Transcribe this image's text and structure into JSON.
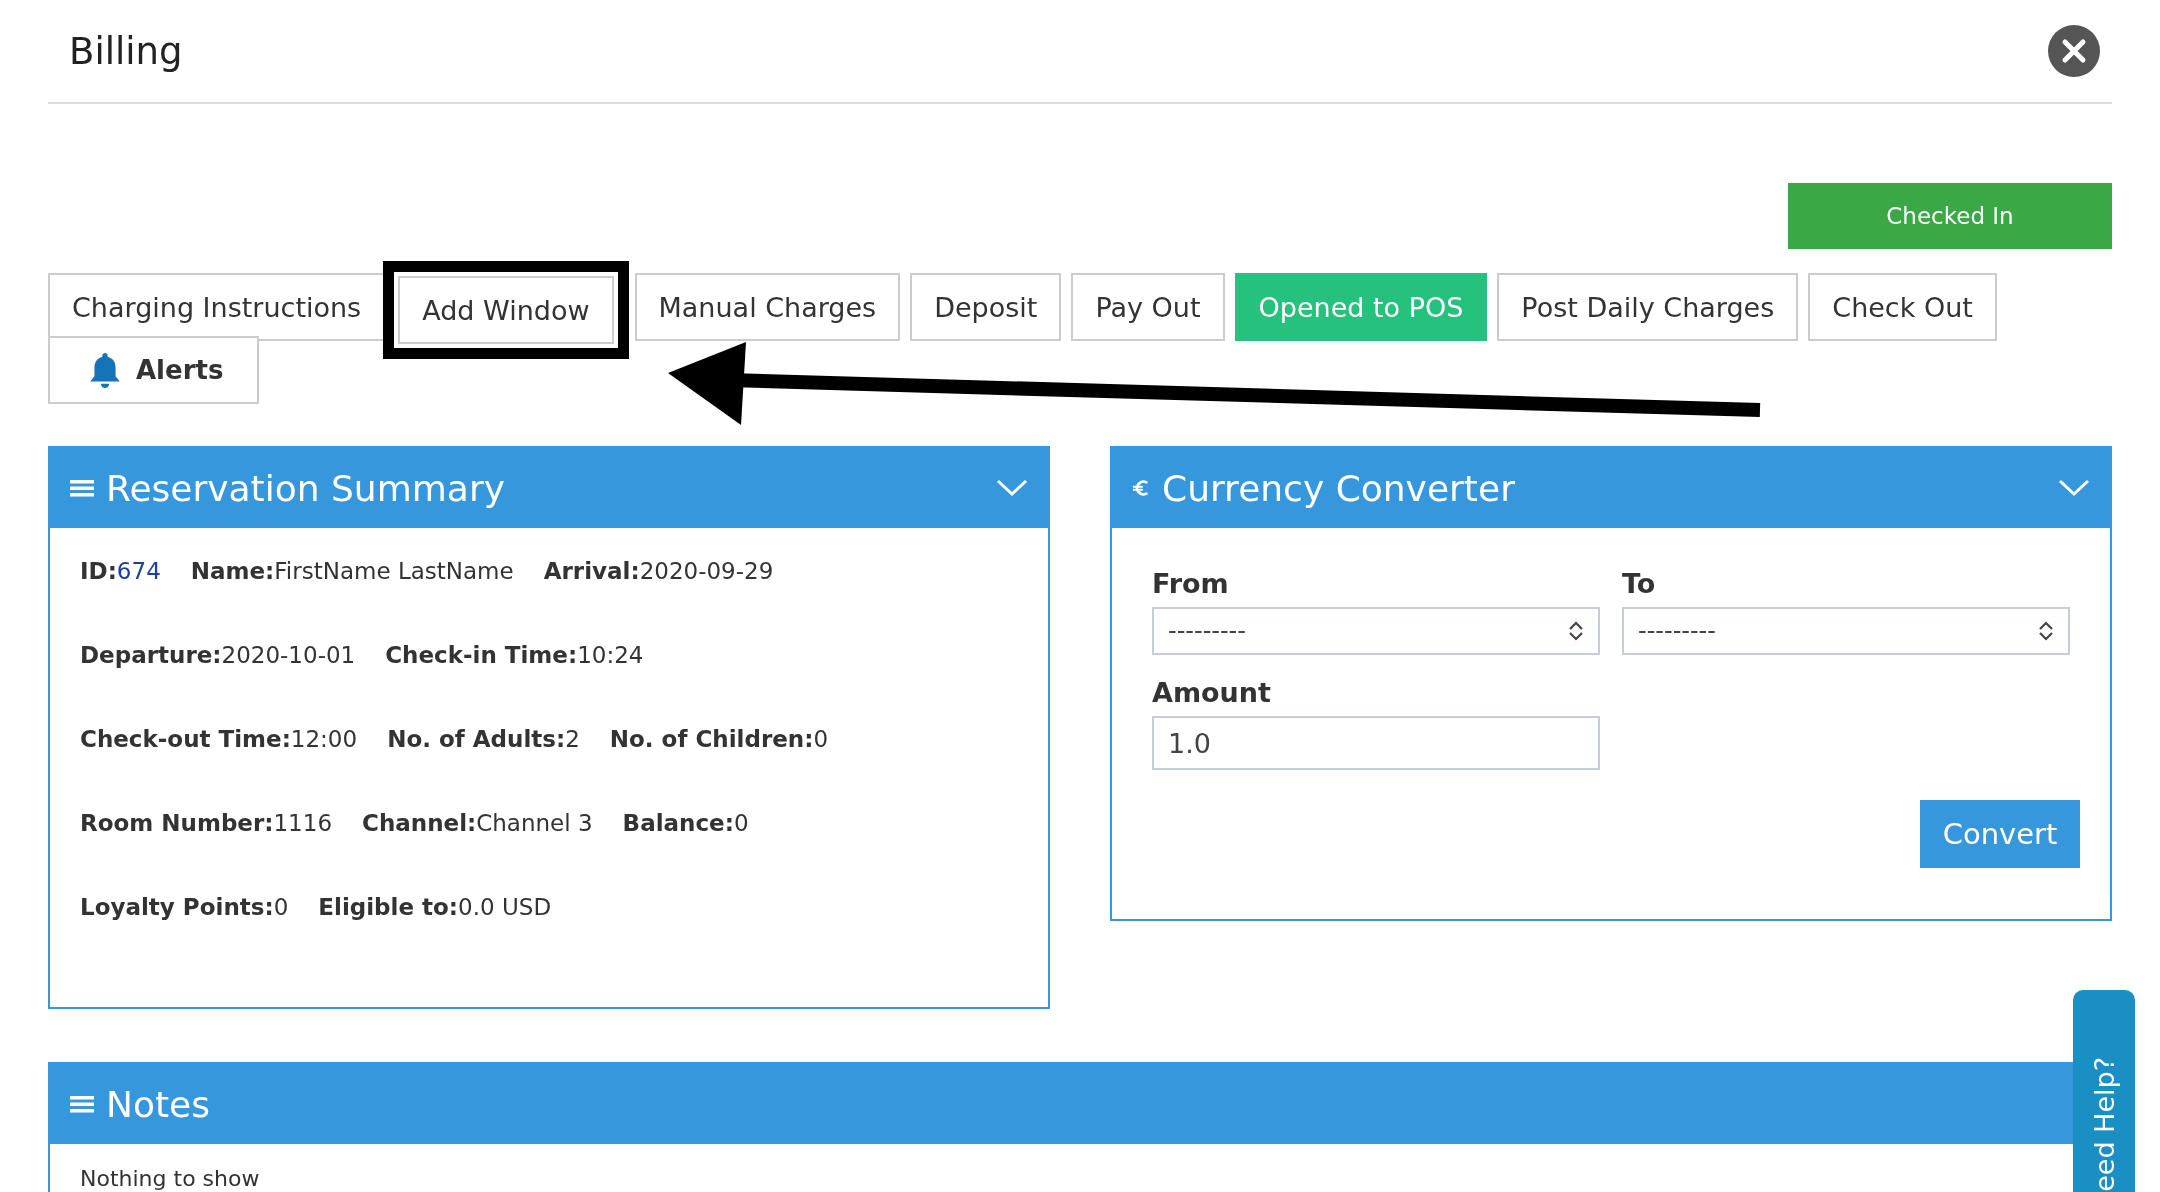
{
  "dialog": {
    "title": "Billing"
  },
  "status_button": {
    "label": "Checked In"
  },
  "buttons": [
    {
      "label": "Charging Instructions",
      "active": false,
      "framed": false
    },
    {
      "label": "Add Window",
      "active": false,
      "framed": true
    },
    {
      "label": "Manual Charges",
      "active": false,
      "framed": false
    },
    {
      "label": "Deposit",
      "active": false,
      "framed": false
    },
    {
      "label": "Pay Out",
      "active": false,
      "framed": false
    },
    {
      "label": "Opened to POS",
      "active": true,
      "framed": false
    },
    {
      "label": "Post Daily Charges",
      "active": false,
      "framed": false
    },
    {
      "label": "Check Out",
      "active": false,
      "framed": false
    }
  ],
  "alerts_button": {
    "label": "Alerts"
  },
  "reservation_summary": {
    "title": "Reservation Summary",
    "rows": [
      [
        {
          "label": "ID:",
          "value": "674",
          "kind": "link"
        },
        {
          "label": "Name:",
          "value": "FirstName LastName",
          "kind": "plain"
        },
        {
          "label": "Arrival:",
          "value": "2020-09-29",
          "kind": "plain"
        }
      ],
      [
        {
          "label": "Departure:",
          "value": "2020-10-01",
          "kind": "plain"
        },
        {
          "label": "Check-in Time:",
          "value": "10:24",
          "kind": "plain"
        }
      ],
      [
        {
          "label": "Check-out Time:",
          "value": "12:00",
          "kind": "plain"
        },
        {
          "label": "No. of Adults:",
          "value": "2",
          "kind": "plain"
        },
        {
          "label": "No. of Children:",
          "value": "0",
          "kind": "plain"
        }
      ],
      [
        {
          "label": "Room Number:",
          "value": "1116",
          "kind": "plain"
        },
        {
          "label": "Channel:",
          "value": "Channel 3",
          "kind": "plain"
        },
        {
          "label": "Balance:",
          "value": "0",
          "kind": "plain"
        }
      ],
      [
        {
          "label": "Loyalty Points:",
          "value": "0",
          "kind": "plain"
        },
        {
          "label": "Eligible to:",
          "value": "0.0 USD",
          "kind": "plain"
        }
      ]
    ]
  },
  "currency_converter": {
    "title": "Currency Converter",
    "from": {
      "label": "From",
      "value": "---------"
    },
    "to": {
      "label": "To",
      "value": "---------"
    },
    "amount": {
      "label": "Amount",
      "value": "1.0"
    },
    "convert_button": {
      "label": "Convert"
    }
  },
  "notes": {
    "title": "Notes",
    "empty_text": "Nothing to show"
  },
  "help_tab": {
    "label": "eed Help?"
  }
}
